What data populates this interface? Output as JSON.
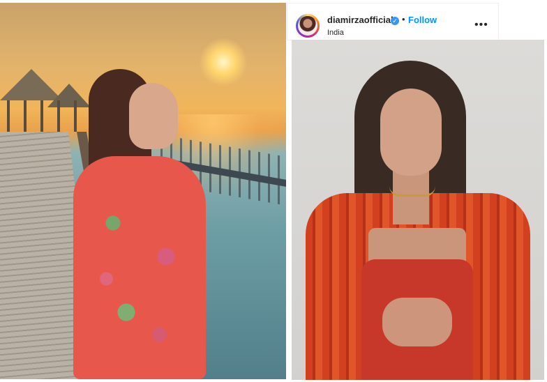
{
  "left_photo": {
    "description_icon": "photo"
  },
  "instagram_post": {
    "username": "diamirzaofficial",
    "verified_icon": "verified-badge-icon",
    "separator": "•",
    "follow_label": "Follow",
    "location": "India",
    "more_icon": "more-options-icon",
    "more_glyph": "•••"
  },
  "colors": {
    "follow_blue": "#0095f6",
    "verified_blue": "#3897f0",
    "text_dark": "#262626"
  }
}
